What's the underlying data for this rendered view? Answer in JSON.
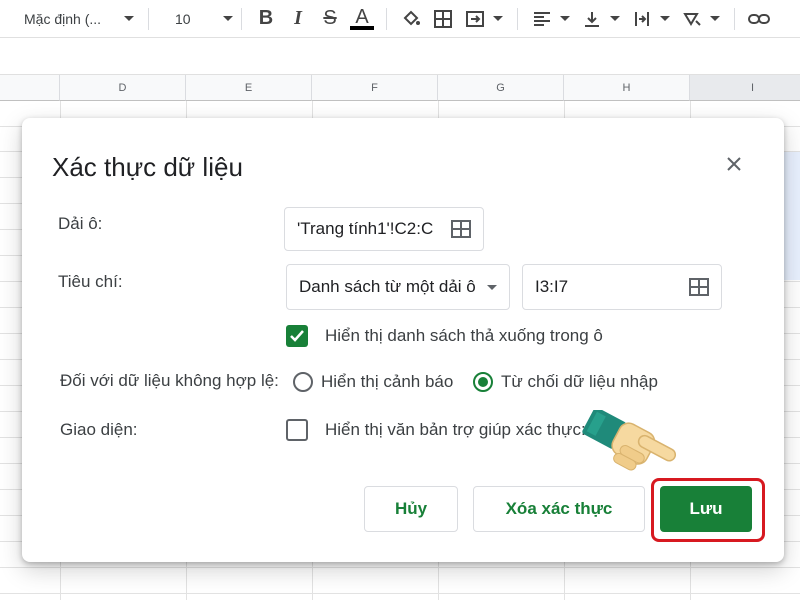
{
  "toolbar": {
    "font_name": "Mặc định (...",
    "font_size": "10",
    "bold_label": "B",
    "italic_label": "I",
    "strike_label": "S",
    "text_color_label": "A",
    "colors": {
      "text_color_bar": "#000000"
    }
  },
  "columns": [
    "D",
    "E",
    "F",
    "G",
    "H",
    "I"
  ],
  "dialog": {
    "title": "Xác thực dữ liệu",
    "range_label": "Dải ô:",
    "range_value": "'Trang tính1'!C2:C",
    "criteria_label": "Tiêu chí:",
    "criteria_select": "Danh sách từ một dải ô",
    "criteria_range": "I3:I7",
    "show_dropdown_label": "Hiển thị danh sách thả xuống trong ô",
    "show_dropdown_checked": true,
    "invalid_label": "Đối với dữ liệu không hợp lệ:",
    "invalid_options": [
      "Hiển thị cảnh báo",
      "Từ chối dữ liệu nhập"
    ],
    "invalid_selected": "Từ chối dữ liệu nhập",
    "appearance_label": "Giao diện:",
    "help_text_label": "Hiển thị văn bản trợ giúp xác thực:",
    "help_text_checked": false,
    "cancel_label": "Hủy",
    "remove_label": "Xóa xác thực",
    "save_label": "Lưu"
  },
  "colors": {
    "accent": "#188038",
    "highlight_border": "#d71920",
    "selection_blue": "#1a73e8"
  }
}
